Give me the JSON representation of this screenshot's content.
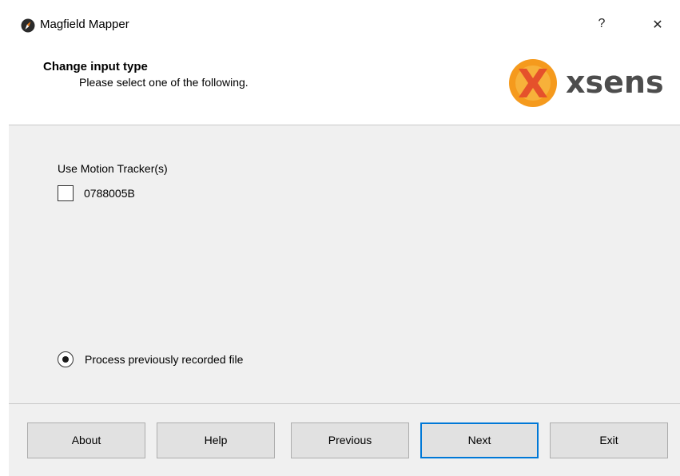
{
  "window": {
    "title": "Magfield Mapper",
    "app_icon": "compass-icon",
    "help_glyph": "?",
    "close_glyph": "✕"
  },
  "header": {
    "title": "Change input type",
    "subtitle": "Please select one of the following.",
    "brand_name": "xsens",
    "brand_color": "#f07f1b",
    "brand_text_color": "#4d4d4d"
  },
  "content": {
    "trackers_label": "Use Motion Tracker(s)",
    "trackers": [
      {
        "id": "0788005B",
        "checked": false
      }
    ],
    "file_option": {
      "label": "Process previously recorded file",
      "selected": true
    }
  },
  "footer": {
    "about_label": "About",
    "help_label": "Help",
    "previous_label": "Previous",
    "next_label": "Next",
    "exit_label": "Exit",
    "default_button": "Next",
    "accent": "#0078d7"
  }
}
